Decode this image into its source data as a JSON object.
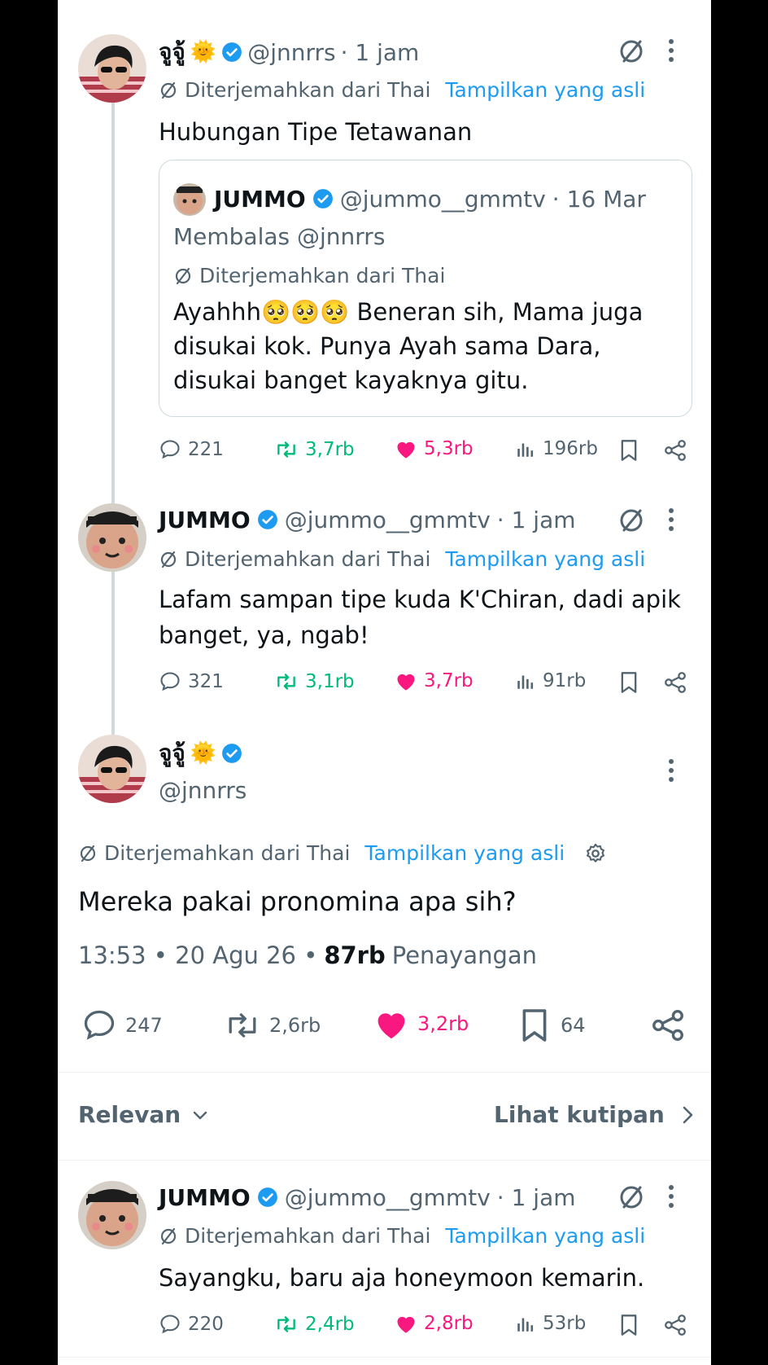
{
  "colors": {
    "like": "#f91880",
    "retweet": "#00ba7c",
    "verified": "#1d9bf0",
    "link": "#1d9bf0",
    "muted": "#536471",
    "text": "#0f1419"
  },
  "reply1": {
    "name": "จูจู้",
    "emoji": "🌞",
    "handle": "@jnnrrs",
    "time": "· 1 jam",
    "translated": "Diterjemahkan dari Thai",
    "show_original": "Tampilkan yang asli",
    "text": "Hubungan Tipe Tetawanan",
    "quote": {
      "name": "JUMMO",
      "handle": "@jummo__gmmtv",
      "time": "· 16 Mar",
      "replying": "Membalas @jnnrrs",
      "translated": "Diterjemahkan dari Thai",
      "text_line1": "Ayahhh🥺🥺🥺 Beneran sih, Mama juga",
      "text_line2": "disukai kok. Punya Ayah sama Dara,",
      "text_line3": "disukai banget kayaknya gitu."
    },
    "replies": "221",
    "retweets": "3,7rb",
    "likes": "5,3rb",
    "views": "196rb"
  },
  "reply2": {
    "name": "JUMMO",
    "handle": "@jummo__gmmtv",
    "time": "· 1 jam",
    "translated": "Diterjemahkan dari Thai",
    "show_original": "Tampilkan yang asli",
    "text_line1": "Lafam sampan tipe kuda K'Chiran, dadi apik",
    "text_line2": "banget, ya, ngab!",
    "replies": "321",
    "retweets": "3,1rb",
    "likes": "3,7rb",
    "views": "91rb"
  },
  "main": {
    "name": "จูจู้",
    "emoji": "🌞",
    "handle": "@jnnrrs",
    "translated": "Diterjemahkan dari Thai",
    "show_original": "Tampilkan yang asli",
    "text": "Mereka pakai pronomina apa sih?",
    "timestamp": "13:53 • 20 Agu 26 •",
    "views_count": "87rb",
    "views_label": "Penayangan",
    "replies": "247",
    "retweets": "2,6rb",
    "likes": "3,2rb",
    "bookmarks": "64"
  },
  "sort": {
    "label": "Relevan",
    "quotes_link": "Lihat kutipan"
  },
  "reply3": {
    "name": "JUMMO",
    "handle": "@jummo__gmmtv",
    "time": "· 1 jam",
    "translated": "Diterjemahkan dari Thai",
    "show_original": "Tampilkan yang asli",
    "text": "Sayangku, baru aja honeymoon kemarin.",
    "replies": "220",
    "retweets": "2,4rb",
    "likes": "2,8rb",
    "views": "53rb"
  }
}
